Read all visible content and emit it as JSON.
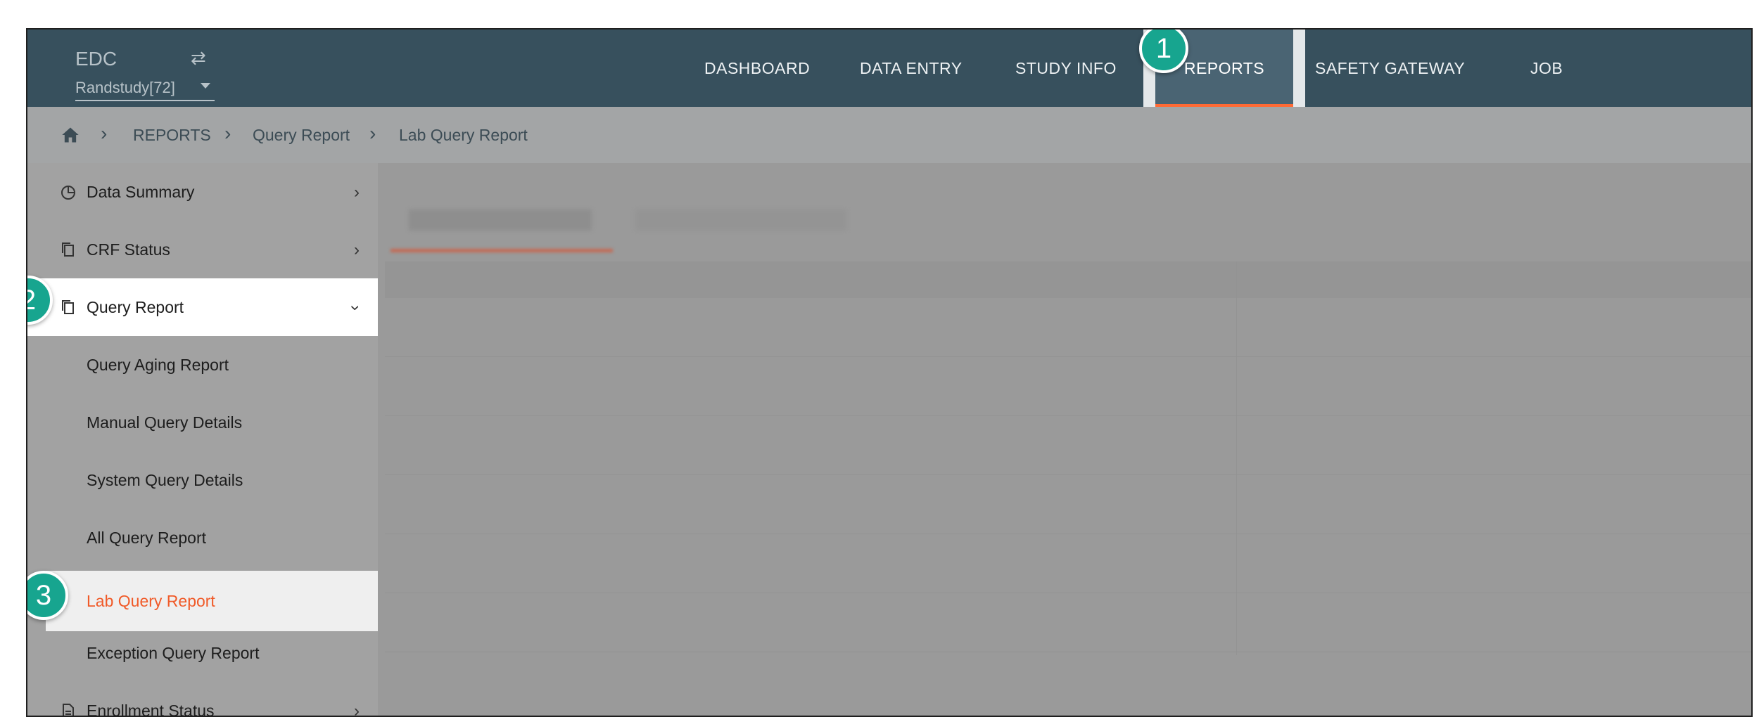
{
  "app": {
    "brand": "EDC",
    "study_selector": "Randstudy[72]"
  },
  "nav": {
    "items": [
      "DASHBOARD",
      "DATA ENTRY",
      "STUDY INFO",
      "REPORTS",
      "SAFETY GATEWAY",
      "JOB"
    ],
    "active": "REPORTS"
  },
  "breadcrumb": {
    "items": [
      "REPORTS",
      "Query Report",
      "Lab Query Report"
    ]
  },
  "sidebar": {
    "items": [
      {
        "label": "Data Summary",
        "icon": "pie-chart-icon"
      },
      {
        "label": "CRF Status",
        "icon": "copy-document-icon"
      },
      {
        "label": "Query Report",
        "icon": "copy-document-icon",
        "expanded": true,
        "children": [
          "Query Aging Report",
          "Manual Query Details",
          "System Query Details",
          "All Query Report",
          "Lab Query Report",
          "Exception Query Report"
        ]
      },
      {
        "label": "Enrollment Status",
        "icon": "document-icon"
      }
    ],
    "selected_child": "Lab Query Report"
  },
  "callouts": [
    "1",
    "2",
    "3"
  ],
  "colors": {
    "header": "#37505d",
    "accent": "#f05a28",
    "callout": "#17a58f"
  }
}
